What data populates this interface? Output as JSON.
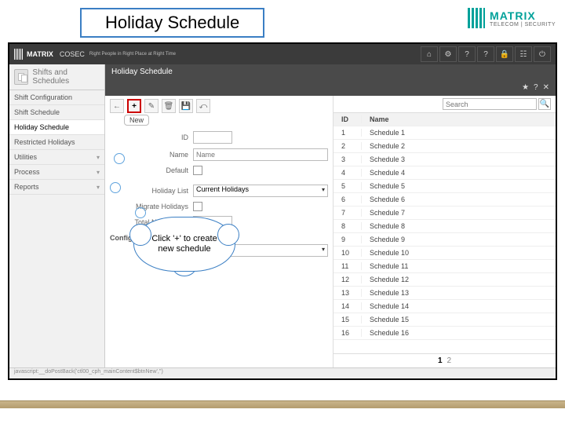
{
  "title": "Holiday Schedule",
  "brand": {
    "name": "MATRIX",
    "sub": "TELECOM | SECURITY"
  },
  "app": {
    "logo": "MATRIX",
    "product": "COSEC",
    "tagline": "Right People in Right Place at Right Time",
    "header_icons": [
      "home-icon",
      "gear-icon",
      "help-icon",
      "question-icon",
      "lock-icon",
      "grid-icon",
      "power-icon"
    ]
  },
  "sidebar": {
    "head": "Shifts and Schedules",
    "items": [
      {
        "label": "Shift Configuration",
        "expand": false
      },
      {
        "label": "Shift Schedule",
        "expand": false
      },
      {
        "label": "Holiday Schedule",
        "expand": false,
        "active": true
      },
      {
        "label": "Restricted Holidays",
        "expand": false
      },
      {
        "label": "Utilities",
        "expand": true
      },
      {
        "label": "Process",
        "expand": true
      },
      {
        "label": "Reports",
        "expand": true
      }
    ]
  },
  "panel": {
    "title": "Holiday Schedule",
    "subbar": [
      "star-icon",
      "help-icon",
      "close-icon"
    ]
  },
  "toolbar": {
    "new_tooltip": "New",
    "buttons": [
      "back-icon",
      "new-icon",
      "edit-icon",
      "delete-icon",
      "save-icon",
      "cancel-icon"
    ]
  },
  "form": {
    "id_label": "ID",
    "id_value": "",
    "name_label": "Name",
    "name_placeholder": "Name",
    "default_label": "Default",
    "holiday_list_label": "Holiday List",
    "holiday_list_value": "Current Holidays",
    "migrate_label": "Migrate Holidays",
    "total_days_label": "Total No. of Days",
    "total_days_value": "",
    "configure_label": "Configure Holidays"
  },
  "list": {
    "search_placeholder": "Search",
    "col_id": "ID",
    "col_name": "Name",
    "rows": [
      {
        "id": "1",
        "name": "Schedule 1"
      },
      {
        "id": "2",
        "name": "Schedule 2"
      },
      {
        "id": "3",
        "name": "Schedule 3"
      },
      {
        "id": "4",
        "name": "Schedule 4"
      },
      {
        "id": "5",
        "name": "Schedule 5"
      },
      {
        "id": "6",
        "name": "Schedule 6"
      },
      {
        "id": "7",
        "name": "Schedule 7"
      },
      {
        "id": "8",
        "name": "Schedule 8"
      },
      {
        "id": "9",
        "name": "Schedule 9"
      },
      {
        "id": "10",
        "name": "Schedule 10"
      },
      {
        "id": "11",
        "name": "Schedule 11"
      },
      {
        "id": "12",
        "name": "Schedule 12"
      },
      {
        "id": "13",
        "name": "Schedule 13"
      },
      {
        "id": "14",
        "name": "Schedule 14"
      },
      {
        "id": "15",
        "name": "Schedule 15"
      },
      {
        "id": "16",
        "name": "Schedule 16"
      }
    ],
    "pager": {
      "current": "1",
      "next": "2"
    }
  },
  "callout": "Click '+' to create new schedule",
  "status": "javascript:__doPostBack('ctl00_cph_mainContent$btnNew','')"
}
